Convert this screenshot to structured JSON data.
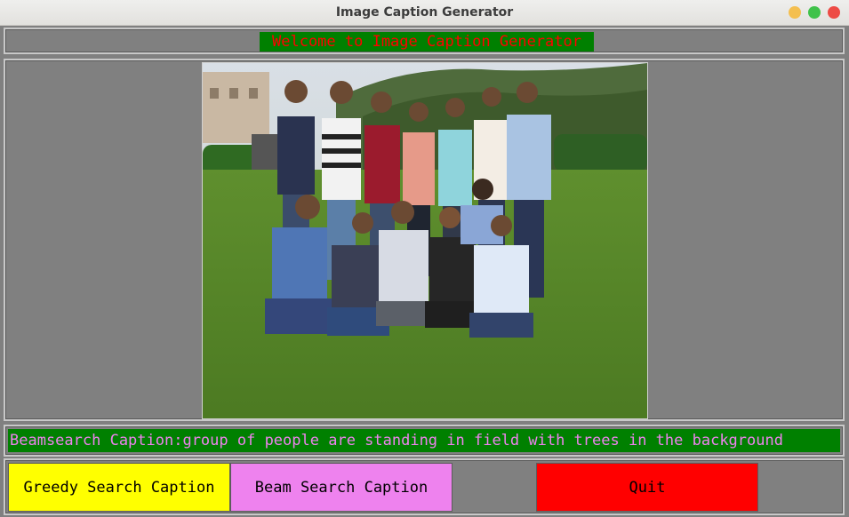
{
  "window": {
    "title": "Image Caption Generator"
  },
  "header": {
    "welcome": "Welcome to Image Caption Generator"
  },
  "image": {
    "subject": "group photo"
  },
  "caption": {
    "text": "Beamsearch Caption:group of people are standing in field with trees in the background"
  },
  "buttons": {
    "greedy": "Greedy Search Caption",
    "beam": "Beam Search Caption",
    "quit": "Quit"
  },
  "colors": {
    "welcome_bg": "#008000",
    "welcome_text": "#ff0000",
    "caption_text": "#ee82ee",
    "greedy_bg": "#ffff00",
    "beam_bg": "#ee82ee",
    "quit_bg": "#ff0000"
  }
}
